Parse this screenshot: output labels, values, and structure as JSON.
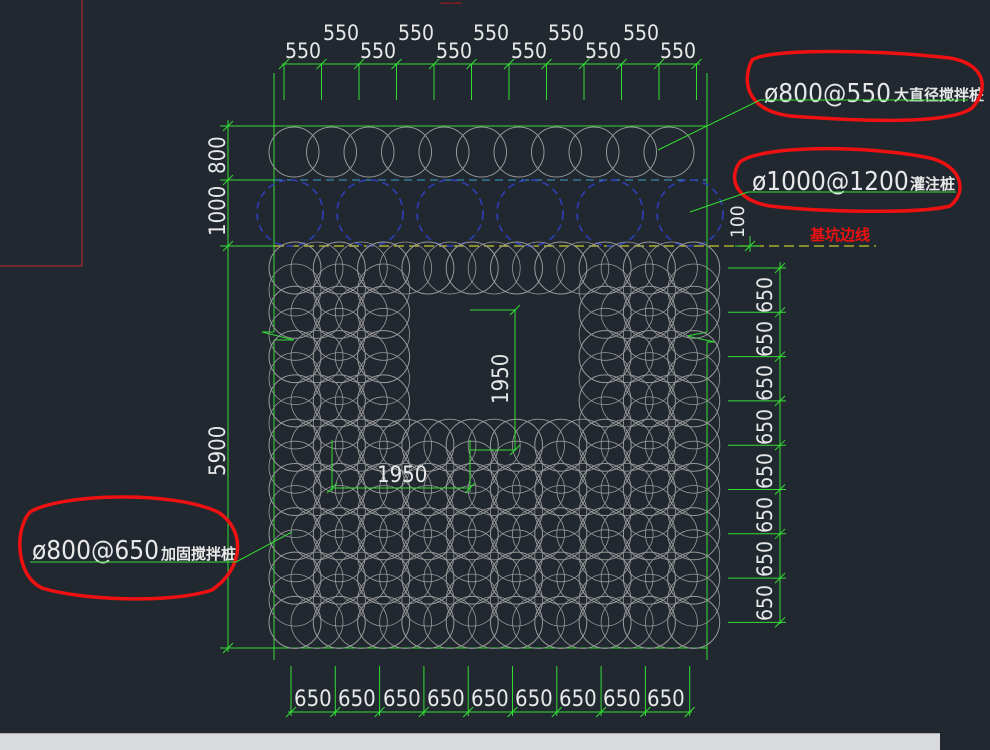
{
  "drawing": {
    "top_dims": [
      "550",
      "550",
      "550",
      "550",
      "550",
      "550",
      "550",
      "550",
      "550",
      "550",
      "550"
    ],
    "right_dims": [
      "650",
      "650",
      "650",
      "650",
      "650",
      "650",
      "650",
      "650"
    ],
    "bottom_dims": [
      "650",
      "650",
      "650",
      "650",
      "650",
      "650",
      "650",
      "650",
      "650"
    ],
    "left_dims": [
      "800",
      "1000",
      "5900"
    ],
    "small_dim": "100",
    "inner_dim_vertical": "1950",
    "inner_dim_horizontal": "1950",
    "label_top": "ø800@550",
    "label_top_cn": "大直径搅拌桩",
    "label_mid": "ø1000@1200",
    "label_mid_cn": "灌注桩",
    "label_left": "ø800@650",
    "label_left_cn": "加固搅拌桩",
    "pit_line_label": "基坑边线",
    "colors": {
      "background": "#212830",
      "dimension": "#33dd33",
      "circle": "#9a9a9a",
      "dashed_blue": "#2f3fbf",
      "yellow_line": "#c8c82a",
      "red_mark": "#ee1111"
    }
  }
}
